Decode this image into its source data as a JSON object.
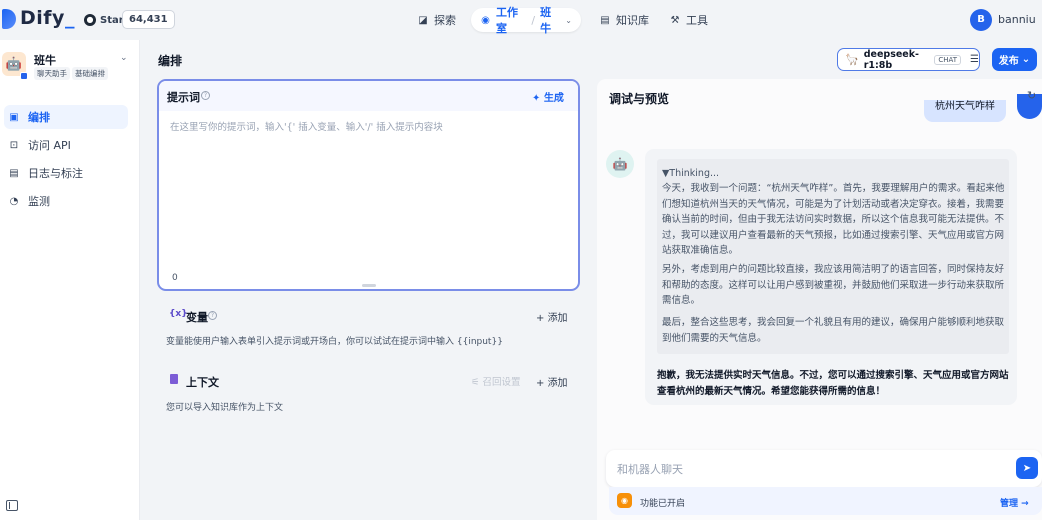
{
  "header": {
    "logo_text": "Dify",
    "github_label": "Star",
    "star_count": "64,431",
    "nav_explore": "探索",
    "nav_studio": "工作室",
    "nav_app": "班牛",
    "nav_knowledge": "知识库",
    "nav_tools": "工具",
    "user_initial": "B",
    "user_name": "banniu"
  },
  "sidebar": {
    "app_name": "班牛",
    "tags": [
      "聊天助手",
      "基础编排"
    ],
    "items": [
      {
        "label": "编排",
        "active": true
      },
      {
        "label": "访问 API",
        "active": false
      },
      {
        "label": "日志与标注",
        "active": false
      },
      {
        "label": "监测",
        "active": false
      }
    ]
  },
  "editor": {
    "title": "编排",
    "prompt_label": "提示词",
    "generate_label": "生成",
    "prompt_placeholder": "在这里写你的提示词，输入'{' 插入变量、输入'/' 插入提示内容块",
    "prompt_count": "0",
    "variables_label": "变量",
    "variables_add": "添加",
    "variables_desc": "变量能使用户输入表单引入提示词或开场白，你可以试试在提示词中输入 {{input}}",
    "context_label": "上下文",
    "context_settings": "召回设置",
    "context_add": "添加",
    "context_desc": "您可以导入知识库作为上下文"
  },
  "model": {
    "name": "deepseek-r1:8b",
    "mode_tag": "CHAT",
    "publish_label": "发布"
  },
  "preview": {
    "title": "调试与预览",
    "user_message": "杭州天气咋样",
    "thinking_header": "▼Thinking...",
    "thinking_p1": "今天，我收到一个问题：“杭州天气咋样”。首先，我要理解用户的需求。看起来他们想知道杭州当天的天气情况，可能是为了计划活动或者决定穿衣。接着，我需要确认当前的时间，但由于我无法访问实时数据，所以这个信息我可能无法提供。不过，我可以建议用户查看最新的天气预报，比如通过搜索引擎、天气应用或官方网站获取准确信息。",
    "thinking_p2": "另外，考虑到用户的问题比较直接，我应该用简洁明了的语言回答，同时保持友好和帮助的态度。这样可以让用户感到被重视，并鼓励他们采取进一步行动来获取所需信息。",
    "thinking_p3": "最后，整合这些思考，我会回复一个礼貌且有用的建议，确保用户能够顺利地获取到他们需要的天气信息。",
    "answer": "抱歉，我无法提供实时天气信息。不过，您可以通过搜索引擎、天气应用或官方网站查看杭州的最新天气情况。希望您能获得所需的信息！",
    "input_placeholder": "和机器人聊天",
    "features_enabled": "功能已开启",
    "manage_label": "管理 →"
  }
}
